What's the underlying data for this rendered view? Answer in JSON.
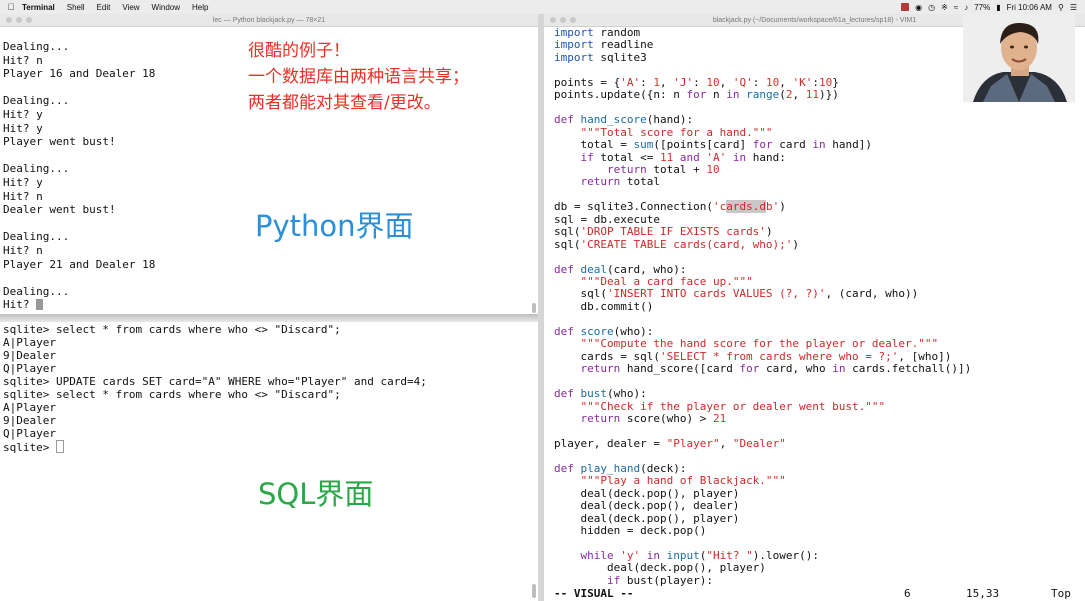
{
  "menubar": {
    "app": "Terminal",
    "items": [
      "Shell",
      "Edit",
      "View",
      "Window",
      "Help"
    ],
    "battery": "77%",
    "clock": "Fri 10:06 AM"
  },
  "terminal": {
    "title": "lec — Python blackjack.py — 78×21",
    "lines": [
      "Dealing...",
      "Hit? n",
      "Player 16 and Dealer 18",
      "",
      "Dealing...",
      "Hit? y",
      "Hit? y",
      "Player went bust!",
      "",
      "Dealing...",
      "Hit? y",
      "Hit? n",
      "Dealer went bust!",
      "",
      "Dealing...",
      "Hit? n",
      "Player 21 and Dealer 18",
      "",
      "Dealing...",
      "Hit? "
    ]
  },
  "sql_terminal": {
    "lines": [
      "sqlite> select * from cards where who <> \"Discard\";",
      "A|Player",
      "9|Dealer",
      "Q|Player",
      "sqlite> UPDATE cards SET card=\"A\" WHERE who=\"Player\" and card=4;",
      "sqlite> select * from cards where who <> \"Discard\";",
      "A|Player",
      "9|Dealer",
      "Q|Player",
      "sqlite> "
    ]
  },
  "annotations": {
    "note_lines": [
      "很酷的例子！",
      "一个数据库由两种语言共享；",
      "两者都能对其查看/更改。"
    ],
    "python_label": "Python界面",
    "sql_label": "SQL界面"
  },
  "vim": {
    "title": "blackjack.py (~/Documents/workspace/61a_lectures/sp18) - VIM1",
    "status_mode": "-- VISUAL --",
    "status_count": "6",
    "status_pos": "15,33",
    "status_scroll": "Top"
  },
  "colors": {
    "red_note": "#e83024",
    "python_label": "#2c8fd8",
    "sql_label": "#2aa847",
    "keyword": "#8a2aa0",
    "import_keyword": "#1f56b3",
    "string": "#cc2a2a"
  }
}
